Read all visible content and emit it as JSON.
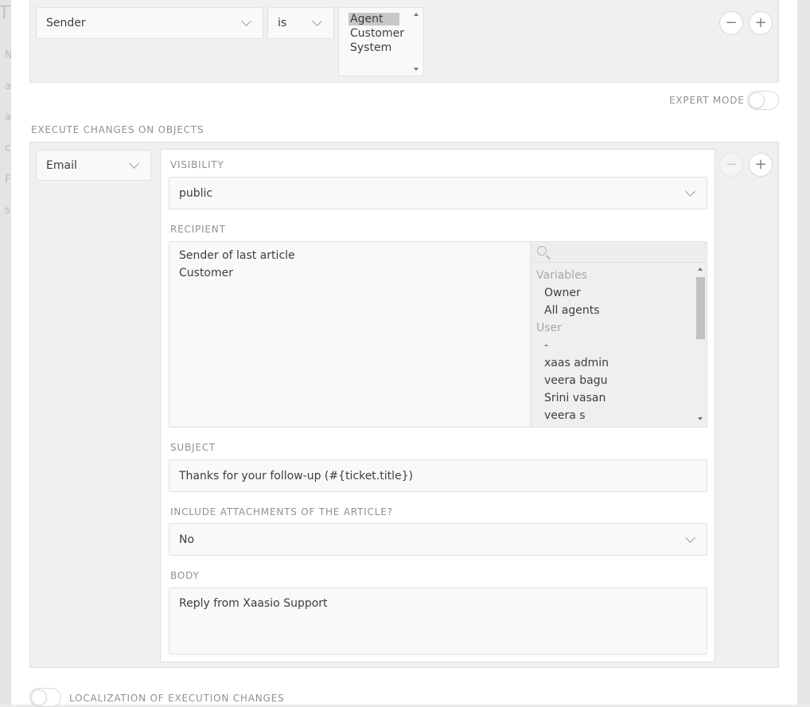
{
  "backdrop": {
    "title_fragment": "Tı",
    "letters": [
      "N",
      "a",
      "a",
      "c",
      "F",
      "s"
    ]
  },
  "condition": {
    "attribute": "Sender",
    "operator": "is",
    "options": [
      "Agent",
      "Customer",
      "System"
    ],
    "selected": "Agent"
  },
  "expert_mode": {
    "label": "EXPERT MODE",
    "enabled": false
  },
  "execute_section": {
    "title": "EXECUTE CHANGES ON OBJECTS",
    "object": "Email",
    "visibility": {
      "label": "VISIBILITY",
      "value": "public"
    },
    "recipient": {
      "label": "RECIPIENT",
      "selected": [
        "Sender of last article",
        "Customer"
      ],
      "search_placeholder": "",
      "groups": [
        {
          "name": "Variables",
          "items": [
            "Owner",
            "All agents"
          ]
        },
        {
          "name": "User",
          "items": [
            "-",
            "xaas admin",
            "veera bagu",
            "Srini vasan",
            "veera s"
          ]
        }
      ]
    },
    "subject": {
      "label": "SUBJECT",
      "value": "Thanks for your follow-up (#{ticket.title})"
    },
    "attachments": {
      "label": "INCLUDE ATTACHMENTS OF THE ARTICLE?",
      "value": "No"
    },
    "body": {
      "label": "BODY",
      "value": "Reply from Xaasio Support"
    }
  },
  "localization": {
    "label": "LOCALIZATION OF EXECUTION CHANGES",
    "enabled": false
  },
  "buttons": {
    "remove": "−",
    "add": "+"
  },
  "colors": {
    "panel": "#eef1f0",
    "field": "#f8f9f9",
    "selected_option": "#c8c8c8"
  }
}
